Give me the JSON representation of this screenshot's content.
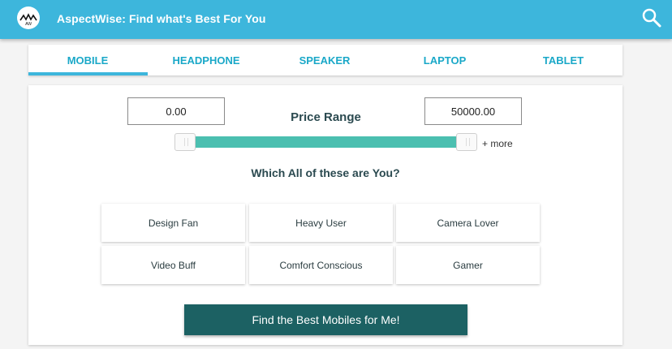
{
  "app": {
    "title": "AspectWise: Find what's Best For You",
    "logo_text": "AW",
    "brand_color": "#3db6dc"
  },
  "tabs": [
    {
      "label": "MOBILE",
      "active": true
    },
    {
      "label": "HEADPHONE",
      "active": false
    },
    {
      "label": "SPEAKER",
      "active": false
    },
    {
      "label": "LAPTOP",
      "active": false
    },
    {
      "label": "TABLET",
      "active": false
    }
  ],
  "price": {
    "label": "Price Range",
    "min_value": "0.00",
    "max_value": "50000.00",
    "more_label": "+ more",
    "slider_color": "#4bbfb0"
  },
  "personas": {
    "question": "Which All of these are You?",
    "options": [
      "Design Fan",
      "Heavy User",
      "Camera Lover",
      "Video Buff",
      "Comfort Conscious",
      "Gamer"
    ]
  },
  "cta": {
    "label": "Find the Best Mobiles for Me!",
    "color": "#1c6163"
  },
  "icons": {
    "search": "search-icon",
    "logo": "logo-icon"
  }
}
